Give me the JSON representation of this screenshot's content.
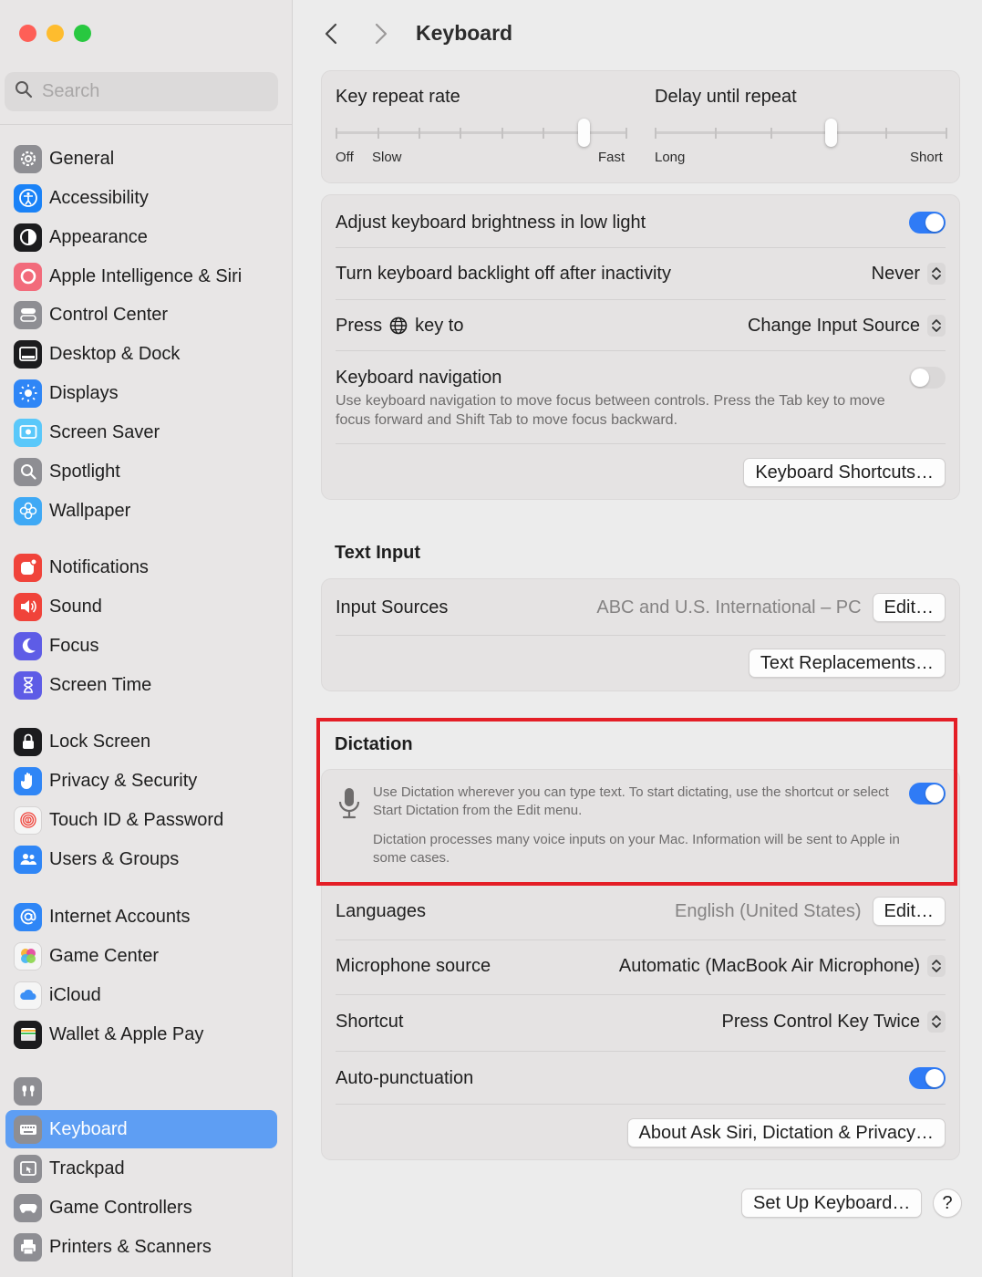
{
  "sidebar": {
    "search_placeholder": "Search",
    "items": [
      {
        "label": "General",
        "icon": "gear-icon",
        "color": "#8e8e93"
      },
      {
        "label": "Accessibility",
        "icon": "accessibility-icon",
        "color": "#1a82f7"
      },
      {
        "label": "Appearance",
        "icon": "appearance-icon",
        "color": "#1c1c1e"
      },
      {
        "label": "Apple Intelligence & Siri",
        "icon": "apple-intelligence-icon",
        "color": "#f26b7b"
      },
      {
        "label": "Control Center",
        "icon": "control-center-icon",
        "color": "#8e8e93"
      },
      {
        "label": "Desktop & Dock",
        "icon": "dock-icon",
        "color": "#1c1c1e"
      },
      {
        "label": "Displays",
        "icon": "displays-icon",
        "color": "#2f86f6"
      },
      {
        "label": "Screen Saver",
        "icon": "screen-saver-icon",
        "color": "#5ac8fa"
      },
      {
        "label": "Spotlight",
        "icon": "spotlight-icon",
        "color": "#8e8e93"
      },
      {
        "label": "Wallpaper",
        "icon": "wallpaper-icon",
        "color": "#3fa9f5"
      },
      {
        "label": "Notifications",
        "icon": "notifications-icon",
        "color": "#f0433a"
      },
      {
        "label": "Sound",
        "icon": "sound-icon",
        "color": "#f0433a"
      },
      {
        "label": "Focus",
        "icon": "focus-icon",
        "color": "#5e5ce6"
      },
      {
        "label": "Screen Time",
        "icon": "screen-time-icon",
        "color": "#5e5ce6"
      },
      {
        "label": "Lock Screen",
        "icon": "lock-icon",
        "color": "#1c1c1e"
      },
      {
        "label": "Privacy & Security",
        "icon": "hand-icon",
        "color": "#2f86f6"
      },
      {
        "label": "Touch ID & Password",
        "icon": "fingerprint-icon",
        "color": "#f5f5f5"
      },
      {
        "label": "Users & Groups",
        "icon": "users-icon",
        "color": "#2f86f6"
      },
      {
        "label": "Internet Accounts",
        "icon": "at-icon",
        "color": "#2f86f6"
      },
      {
        "label": "Game Center",
        "icon": "game-center-icon",
        "color": "#f5f5f5"
      },
      {
        "label": "iCloud",
        "icon": "icloud-icon",
        "color": "#f5f5f5"
      },
      {
        "label": "Wallet & Apple Pay",
        "icon": "wallet-icon",
        "color": "#1c1c1e"
      },
      {
        "label": "",
        "icon": "airpods-icon",
        "color": "#8e8e93"
      },
      {
        "label": "Keyboard",
        "icon": "keyboard-icon",
        "color": "#8e8e93",
        "active": true
      },
      {
        "label": "Trackpad",
        "icon": "trackpad-icon",
        "color": "#8e8e93"
      },
      {
        "label": "Game Controllers",
        "icon": "game-controller-icon",
        "color": "#8e8e93"
      },
      {
        "label": "Printers & Scanners",
        "icon": "printer-icon",
        "color": "#8e8e93"
      }
    ]
  },
  "header": {
    "title": "Keyboard"
  },
  "repeat": {
    "key_repeat_label": "Key repeat rate",
    "key_repeat_off": "Off",
    "key_repeat_slow": "Slow",
    "key_repeat_fast": "Fast",
    "key_repeat_value_fraction": 0.85,
    "delay_label": "Delay until repeat",
    "delay_long": "Long",
    "delay_short": "Short",
    "delay_value_fraction": 0.6
  },
  "settings": {
    "brightness_label": "Adjust keyboard brightness in low light",
    "brightness_on": true,
    "backlight_label": "Turn keyboard backlight off after inactivity",
    "backlight_value": "Never",
    "press_label_pre": "Press",
    "press_label_post": "key to",
    "press_value": "Change Input Source",
    "nav_label": "Keyboard navigation",
    "nav_desc": "Use keyboard navigation to move focus between controls. Press the Tab key to move focus forward and Shift Tab to move focus backward.",
    "nav_on": false,
    "shortcuts_button": "Keyboard Shortcuts…"
  },
  "text_input": {
    "section_title": "Text Input",
    "sources_label": "Input Sources",
    "sources_value": "ABC and U.S. International – PC",
    "edit_button": "Edit…",
    "replacements_button": "Text Replacements…"
  },
  "dictation": {
    "section_title": "Dictation",
    "desc1": "Use Dictation wherever you can type text. To start dictating, use the shortcut or select Start Dictation from the Edit menu.",
    "desc2": "Dictation processes many voice inputs on your Mac. Information will be sent to Apple in some cases.",
    "enabled": true,
    "languages_label": "Languages",
    "languages_value": "English (United States)",
    "languages_edit": "Edit…",
    "mic_label": "Microphone source",
    "mic_value": "Automatic (MacBook Air Microphone)",
    "shortcut_label": "Shortcut",
    "shortcut_value": "Press Control Key Twice",
    "autopunct_label": "Auto-punctuation",
    "autopunct_on": true,
    "about_button": "About Ask Siri, Dictation & Privacy…"
  },
  "footer": {
    "setup_button": "Set Up Keyboard…",
    "help_button": "?"
  },
  "colors": {
    "accent": "#2f7bf6",
    "sidebar_active": "#5e9ef3",
    "highlight_border": "#e41e26"
  }
}
